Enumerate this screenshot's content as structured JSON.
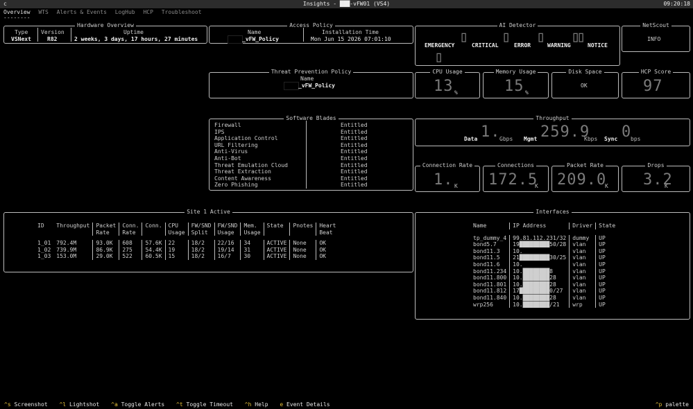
{
  "app": {
    "menu_glyph": "c",
    "title": "Insights - ███-vFW01 (VS4)",
    "clock": "09:20:18"
  },
  "tabs": [
    "Overview",
    "WTS",
    "Alerts & Events",
    "LogHub",
    "HCP",
    "Troubleshoot"
  ],
  "tab_underline": "--------",
  "hardware": {
    "title": "Hardware Overview",
    "type_label": "Type",
    "type_value": "VSNext",
    "version_label": "Version",
    "version_value": "R82",
    "uptime_label": "Uptime",
    "uptime_value": "2 weeks, 3 days, 17 hours, 27 minutes"
  },
  "access_policy": {
    "title": "Access Policy",
    "name_label": "Name",
    "name_value": "_vFW_Policy",
    "install_label": "Installation Time",
    "install_value": "Mon Jun 15 2026 07:01:10"
  },
  "ai_detector": {
    "title": "AI Detector",
    "levels": [
      "EMERGENCY",
      "CRITICAL",
      "ERROR",
      "WARNING",
      "NOTICE"
    ]
  },
  "netscout": {
    "title": "NetScout",
    "value": "INFO"
  },
  "threat_prevention": {
    "title": "Threat Prevention Policy",
    "name_label": "Name",
    "name_value": "_vFW_Policy"
  },
  "cpu_usage": {
    "title": "CPU Usage",
    "value": "13",
    "unit": "%"
  },
  "memory_usage": {
    "title": "Memory Usage",
    "value": "15",
    "unit": "%"
  },
  "disk_space": {
    "title": "Disk Space",
    "value": "OK"
  },
  "hcp_score": {
    "title": "HCP Score",
    "value": "97"
  },
  "software_blades": {
    "title": "Software Blades",
    "rows": [
      {
        "name": "Firewall",
        "status": "Entitled"
      },
      {
        "name": "IPS",
        "status": "Entitled"
      },
      {
        "name": "Application Control",
        "status": "Entitled"
      },
      {
        "name": "URL Filtering",
        "status": "Entitled"
      },
      {
        "name": "Anti-Virus",
        "status": "Entitled"
      },
      {
        "name": "Anti-Bot",
        "status": "Entitled"
      },
      {
        "name": "Threat Emulation Cloud",
        "status": "Entitled"
      },
      {
        "name": "Threat Extraction",
        "status": "Entitled"
      },
      {
        "name": "Content Awareness",
        "status": "Entitled"
      },
      {
        "name": "Zero Phishing",
        "status": "Entitled"
      }
    ]
  },
  "throughput": {
    "title": "Throughput",
    "data_label": "Data",
    "data_value": "1.",
    "data_unit": "Gbps",
    "mgmt_label": "Mgmt",
    "mgmt_value": "259.9",
    "mgmt_unit": "Kbps",
    "sync_label": "Sync",
    "sync_value": "0",
    "sync_unit": "bps"
  },
  "connection_rate": {
    "title": "Connection Rate",
    "value": "1.",
    "unit": "K"
  },
  "connections": {
    "title": "Connections",
    "value": "172.5",
    "unit": "K"
  },
  "packet_rate": {
    "title": "Packet Rate",
    "value": "209.0",
    "unit": "K"
  },
  "drops": {
    "title": "Drops",
    "value": "3.2",
    "unit": "K"
  },
  "site": {
    "title": "Site 1 Active",
    "headers": [
      [
        "ID",
        ""
      ],
      [
        "Throughput",
        ""
      ],
      [
        "Packet",
        "Rate"
      ],
      [
        "Conn.",
        "Rate"
      ],
      [
        "Conn.",
        ""
      ],
      [
        "CPU",
        "Usage"
      ],
      [
        "FW/SND",
        "Split"
      ],
      [
        "FW/SND",
        "Usage"
      ],
      [
        "Mem.",
        "Usage"
      ],
      [
        "State",
        ""
      ],
      [
        "Pnotes",
        ""
      ],
      [
        "Heart",
        "Beat"
      ]
    ],
    "rows": [
      [
        "1_01",
        "792.4M",
        "93.0K",
        "608",
        "57.6K",
        "22",
        "18/2",
        "22/16",
        "34",
        "ACTIVE",
        "None",
        "OK"
      ],
      [
        "1_02",
        "739.9M",
        "86.9K",
        "275",
        "54.4K",
        "19",
        "18/2",
        "19/14",
        "31",
        "ACTIVE",
        "None",
        "OK"
      ],
      [
        "1_03",
        "153.0M",
        "29.0K",
        "522",
        "60.5K",
        "15",
        "18/2",
        "16/7",
        "30",
        "ACTIVE",
        "None",
        "OK"
      ]
    ]
  },
  "interfaces": {
    "title": "Interfaces",
    "headers": [
      "Name",
      "IP Address",
      "Driver",
      "State"
    ],
    "rows": [
      [
        "tp_dummy_4",
        "99.81.112.231/32",
        "dummy",
        "UP"
      ],
      [
        "bond5.7",
        "19█████████50/28",
        "vlan",
        "UP"
      ],
      [
        "bond11.3",
        "10.",
        "vlan",
        "UP"
      ],
      [
        "bond11.5",
        "21█████████30/25",
        "vlan",
        "UP"
      ],
      [
        "bond11.6",
        "10.",
        "vlan",
        "UP"
      ],
      [
        "bond11.234",
        "10.████████8",
        "vlan",
        "UP"
      ],
      [
        "bond11.800",
        "10.████████28",
        "vlan",
        "UP"
      ],
      [
        "bond11.801",
        "10.████████28",
        "vlan",
        "UP"
      ],
      [
        "bond11.812",
        "17█████████0/27",
        "vlan",
        "UP"
      ],
      [
        "bond11.840",
        "10.████████28",
        "vlan",
        "UP"
      ],
      [
        "wrp256",
        "10.████████/21",
        "wrp",
        "UP"
      ]
    ]
  },
  "shortcuts": [
    {
      "key": "^s",
      "label": "Screenshot"
    },
    {
      "key": "^l",
      "label": "Lightshot"
    },
    {
      "key": "^a",
      "label": "Toggle Alerts"
    },
    {
      "key": "^t",
      "label": "Toggle Timeout"
    },
    {
      "key": "^h",
      "label": "Help"
    },
    {
      "key": "e",
      "label": "Event Details"
    }
  ],
  "palette": {
    "key": "^p",
    "label": "palette"
  },
  "colors": {
    "background": "#000000",
    "text": "#cfcfcf",
    "accent": "#e8c23a",
    "border": "#bdbdbd"
  }
}
